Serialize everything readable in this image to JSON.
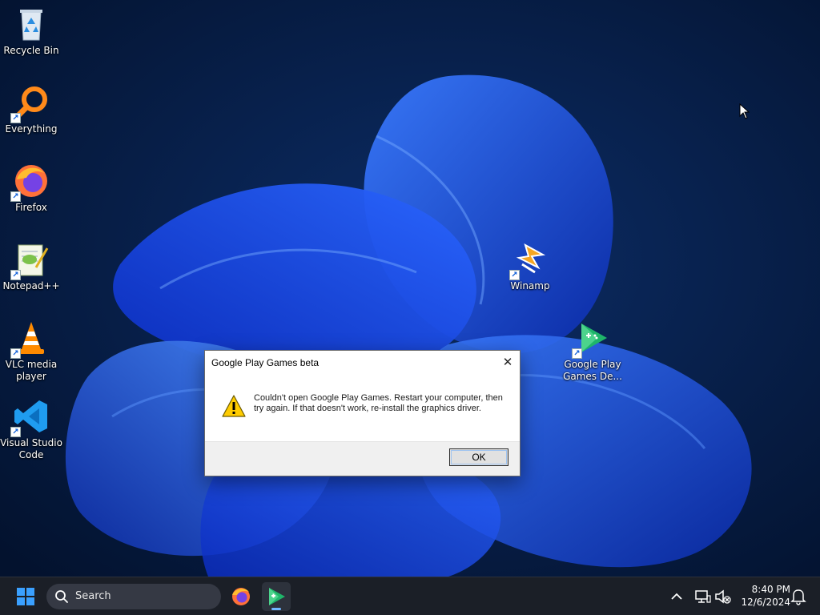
{
  "desktop": {
    "icons": [
      {
        "label": "Recycle Bin"
      },
      {
        "label": "Everything"
      },
      {
        "label": "Firefox"
      },
      {
        "label": "Notepad++"
      },
      {
        "label": "VLC media player"
      },
      {
        "label": "Visual Studio Code"
      },
      {
        "label": "Winamp"
      },
      {
        "label": "Google Play Games De..."
      }
    ]
  },
  "dialog": {
    "title": "Google Play Games beta",
    "message": "Couldn't open Google Play Games. Restart your computer, then try again. If that doesn't work, re-install the graphics driver.",
    "ok_label": "OK",
    "icon": "warning-icon"
  },
  "taskbar": {
    "search_placeholder": "Search",
    "pinned": [
      "firefox-icon",
      "google-play-games-icon"
    ],
    "active_app": "google-play-games-icon"
  },
  "tray": {
    "time": "8:40 PM",
    "date": "12/6/2024",
    "icons": [
      "chevron-up-icon",
      "network-icon",
      "speaker-muted-icon",
      "notification-bell-icon"
    ]
  },
  "colors": {
    "wallpaper_bg": "#061a3a",
    "bloom_blue": "#1e5bff",
    "taskbar_bg": "#1b1f27",
    "active_indicator": "#6fb6ff"
  }
}
